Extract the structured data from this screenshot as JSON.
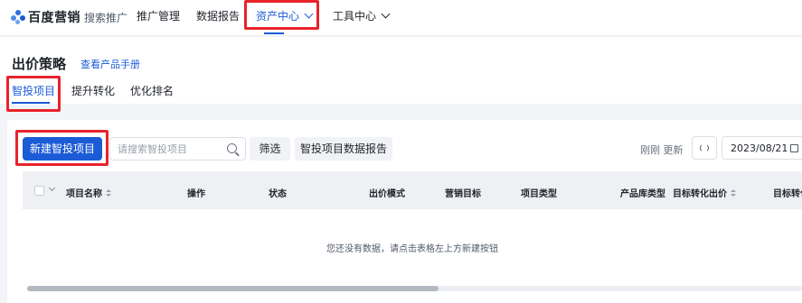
{
  "nav": {
    "logo_text": "百度营销",
    "logo_sub": "搜索推广",
    "items": [
      {
        "label": "推广管理"
      },
      {
        "label": "数据报告"
      },
      {
        "label": "资产中心"
      },
      {
        "label": "工具中心"
      }
    ],
    "active_item": "资产中心"
  },
  "header": {
    "title": "出价策略",
    "manual_link": "查看产品手册",
    "tabs": [
      {
        "label": "智投项目"
      },
      {
        "label": "提升转化"
      },
      {
        "label": "优化排名"
      }
    ],
    "active_tab": "智投项目"
  },
  "toolbar": {
    "new_button": "新建智投项目",
    "search_placeholder": "请搜索智投项目",
    "filter_button": "筛选",
    "report_button": "智投项目数据报告",
    "refresh_text": "刚刚 更新",
    "date": "2023/08/21"
  },
  "table": {
    "columns": [
      {
        "label": "项目名称",
        "sortable": true
      },
      {
        "label": "操作",
        "sortable": false
      },
      {
        "label": "状态",
        "sortable": false
      },
      {
        "label": "出价模式",
        "sortable": false
      },
      {
        "label": "营销目标",
        "sortable": false
      },
      {
        "label": "项目类型",
        "sortable": false
      },
      {
        "label": "产品库类型",
        "sortable": false
      },
      {
        "label": "目标转化出价",
        "sortable": true
      },
      {
        "label": "目标转化",
        "sortable": false
      }
    ],
    "empty_text": "您还没有数据，请点击表格左上方新建按钮"
  },
  "colors": {
    "primary": "#1b5bd6",
    "highlight_box": "#e8232b",
    "page_bg": "#f3f4f7",
    "table_header_bg": "#eef0f4"
  },
  "icons": [
    "logo-icon",
    "chevron-down-icon",
    "search-icon",
    "refresh-icon",
    "calendar-icon",
    "sort-icon"
  ]
}
